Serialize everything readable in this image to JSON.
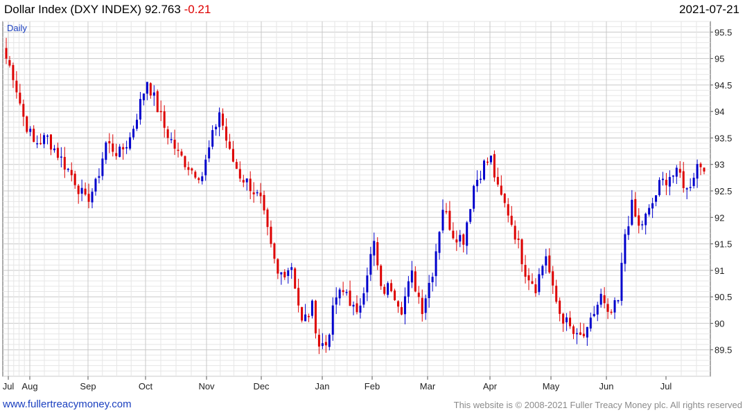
{
  "header": {
    "title": "Dollar Index (DXY INDEX)",
    "last": "92.763",
    "change": "-0.21",
    "date": "2021-07-21"
  },
  "footer": {
    "site": "www.fullertreacymoney.com",
    "copyright": "This website is © 2008-2021 Fuller Treacy Money plc. All rights reserved"
  },
  "chart_data": {
    "type": "candlestick",
    "period_label": "Daily",
    "y_ticks": [
      95.5,
      95,
      94.5,
      94,
      93.5,
      93,
      92.5,
      92,
      91.5,
      91,
      90.5,
      90,
      89.5
    ],
    "ylim": [
      89.0,
      95.7
    ],
    "x_ticks": [
      "Jul",
      "Aug",
      "Sep",
      "Oct",
      "Nov",
      "Dec",
      "Jan",
      "Feb",
      "Mar",
      "Apr",
      "May",
      "Jun",
      "Jul"
    ],
    "up_color": "#0000cc",
    "down_color": "#dd0000",
    "close_path": [
      [
        0,
        95.0
      ],
      [
        2,
        94.7
      ],
      [
        5,
        93.9
      ],
      [
        8,
        93.4
      ],
      [
        12,
        93.5
      ],
      [
        16,
        93.1
      ],
      [
        20,
        92.7
      ],
      [
        23,
        92.3
      ],
      [
        26,
        92.6
      ],
      [
        29,
        93.4
      ],
      [
        33,
        93.2
      ],
      [
        36,
        93.5
      ],
      [
        41,
        94.6
      ],
      [
        46,
        93.7
      ],
      [
        50,
        93.2
      ],
      [
        54,
        92.9
      ],
      [
        57,
        92.8
      ],
      [
        62,
        94.0
      ],
      [
        65,
        93.2
      ],
      [
        68,
        92.8
      ],
      [
        71,
        92.6
      ],
      [
        74,
        92.3
      ],
      [
        77,
        91.4
      ],
      [
        79,
        90.9
      ],
      [
        83,
        91.1
      ],
      [
        86,
        90.0
      ],
      [
        89,
        90.3
      ],
      [
        91,
        89.6
      ],
      [
        93,
        89.6
      ],
      [
        96,
        90.5
      ],
      [
        99,
        90.6
      ],
      [
        102,
        90.1
      ],
      [
        105,
        91.0
      ],
      [
        107,
        91.5
      ],
      [
        109,
        90.6
      ],
      [
        112,
        90.7
      ],
      [
        115,
        90.3
      ],
      [
        118,
        90.9
      ],
      [
        121,
        90.3
      ],
      [
        124,
        91.0
      ],
      [
        127,
        92.2
      ],
      [
        130,
        91.7
      ],
      [
        133,
        91.6
      ],
      [
        136,
        92.6
      ],
      [
        139,
        93.0
      ],
      [
        141,
        93.1
      ],
      [
        143,
        92.5
      ],
      [
        146,
        92.1
      ],
      [
        148,
        91.7
      ],
      [
        151,
        91.0
      ],
      [
        154,
        90.7
      ],
      [
        157,
        91.3
      ],
      [
        159,
        90.6
      ],
      [
        161,
        90.2
      ],
      [
        163,
        90.0
      ],
      [
        166,
        89.7
      ],
      [
        169,
        89.8
      ],
      [
        171,
        90.2
      ],
      [
        173,
        90.5
      ],
      [
        175,
        90.1
      ],
      [
        178,
        90.4
      ],
      [
        180,
        91.7
      ],
      [
        182,
        92.2
      ],
      [
        184,
        91.8
      ],
      [
        187,
        92.1
      ],
      [
        190,
        92.6
      ],
      [
        193,
        92.8
      ],
      [
        196,
        92.8
      ],
      [
        198,
        92.5
      ],
      [
        201,
        93.0
      ],
      [
        203,
        93.0
      ]
    ]
  }
}
